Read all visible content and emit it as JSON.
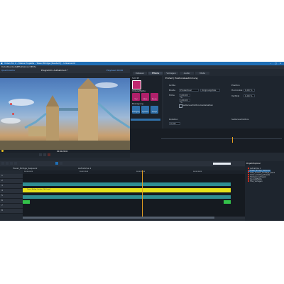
{
  "app": {
    "title": "Video Pro X - Meine Projekte - Tower Bridge [Deutsch] - Unbenannt",
    "menu": [
      "Datei",
      "Bearbeiten",
      "Effekte",
      "Ansicht",
      "Hilfe"
    ]
  },
  "preview": {
    "left_label": "Quellmonitor",
    "center_label": "Programm: Aufnahme 1*",
    "right_label": "Playhead 00:00",
    "timecode": "00:00:26:02"
  },
  "effects": {
    "tabs": [
      "Dateien",
      "Effekte",
      "Vorlagen",
      "Audio",
      "Meta"
    ],
    "active_tab": "Effekte",
    "sections": [
      "Schrift",
      "Videoeffekte",
      "Bewegung"
    ],
    "buttons": [
      "Titel",
      "Effekt",
      "Blende",
      "Bewegung",
      "Dynamik",
      "Spiegel"
    ]
  },
  "properties": {
    "header": "Einheit | Positionsbestimmung",
    "groups": [
      "Größe",
      "Position",
      "Rotation",
      "Seitenverhältnis"
    ],
    "size_labels": [
      "Breite",
      "Höhe"
    ],
    "size_values": [
      "Prozentual",
      "Originalgröße",
      "100,00 %",
      "100,00 %"
    ],
    "position_labels": [
      "Horizontal",
      "Vertikal"
    ],
    "position_values": [
      "0,00 %",
      "0,00 %"
    ],
    "checkbox_label": "Seitenverhältnis beibehalten",
    "rotation_value": "0,00°"
  },
  "timeline": {
    "tabs": [
      "Tower_Bridge_Sequenz",
      "Aufnahme 1"
    ],
    "ruler": [
      "00:00:00:00",
      "00:00:10:00",
      "00:00:20:00",
      "00:00:30:00"
    ],
    "tracks": [
      "1",
      "2",
      "3",
      "4",
      "5",
      "6",
      "7",
      "8"
    ],
    "clip_label": "Tower_Bridge_London_16x9.mp4"
  },
  "explorer": {
    "title": "Projekt-Explorer",
    "items": [
      "Aufnahme 1",
      "Tower_Bridge_Sequenz",
      "Cuts_London_Footage_2023",
      "Color_Grading_Presets",
      "Hintergrundmusik",
      "Soundeffekte",
      "Titel_Vorlagen"
    ]
  },
  "colors": {
    "accent": "#1f6fb6",
    "clip_yellow": "#e6e21a",
    "clip_teal": "#2f8e92",
    "clip_green": "#33c24a",
    "playhead": "#e8a020",
    "effect_magenta": "#b0206a"
  }
}
